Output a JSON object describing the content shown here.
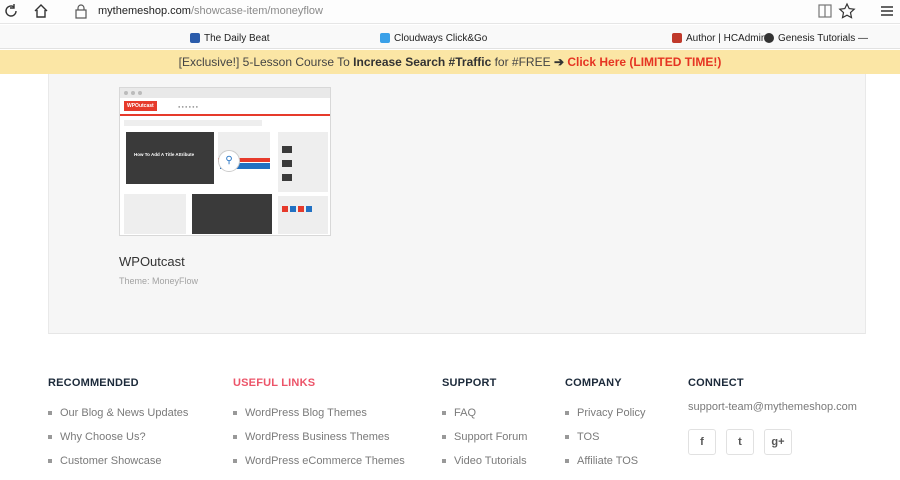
{
  "browser": {
    "url_host": "mythemeshop.com",
    "url_path": "/showcase-item/moneyflow",
    "icons": [
      "refresh-icon",
      "home-icon",
      "lock-icon",
      "reading-view-icon",
      "star-icon",
      "menu-icon"
    ],
    "bookmarks": [
      {
        "label": "The Daily Beat",
        "color": "#2b5cab"
      },
      {
        "label": "Cloudways Click&Go",
        "color": "#3aa0e8"
      },
      {
        "label": "Author | HCAdmin",
        "color": "#c0392b"
      },
      {
        "label": "Genesis Tutorials —",
        "color": "#333333"
      }
    ]
  },
  "promo": {
    "prefix": "[Exclusive!] 5-Lesson Course To ",
    "bold": "Increase Search #Traffic",
    "middle": " for #FREE ",
    "arrow": "➔",
    "cta": "Click Here (LIMITED TIME!)",
    "bg_color": "#fbe6a5",
    "cta_color": "#e53422"
  },
  "showcase": {
    "site_logo": "WPOutcast",
    "thumb_headline": "How To Add A Title Attribute",
    "title": "WPOutcast",
    "theme": "Theme: MoneyFlow"
  },
  "footer": {
    "recommended": {
      "heading": "RECOMMENDED",
      "links": [
        "Our Blog & News Updates",
        "Why Choose Us?",
        "Customer Showcase"
      ]
    },
    "useful_links": {
      "heading": "USEFUL LINKS",
      "links": [
        "WordPress Blog Themes",
        "WordPress Business Themes",
        "WordPress eCommerce Themes"
      ]
    },
    "support": {
      "heading": "SUPPORT",
      "links": [
        "FAQ",
        "Support Forum",
        "Video Tutorials"
      ]
    },
    "company": {
      "heading": "COMPANY",
      "links": [
        "Privacy Policy",
        "TOS",
        "Affiliate TOS"
      ]
    },
    "connect": {
      "heading": "CONNECT",
      "email": "support-team@mythemeshop.com",
      "social": [
        {
          "name": "facebook-icon",
          "glyph": "f"
        },
        {
          "name": "twitter-icon",
          "glyph": "t"
        },
        {
          "name": "google-plus-icon",
          "glyph": "g+"
        }
      ]
    },
    "heading_accent_color": "#ec5469"
  }
}
